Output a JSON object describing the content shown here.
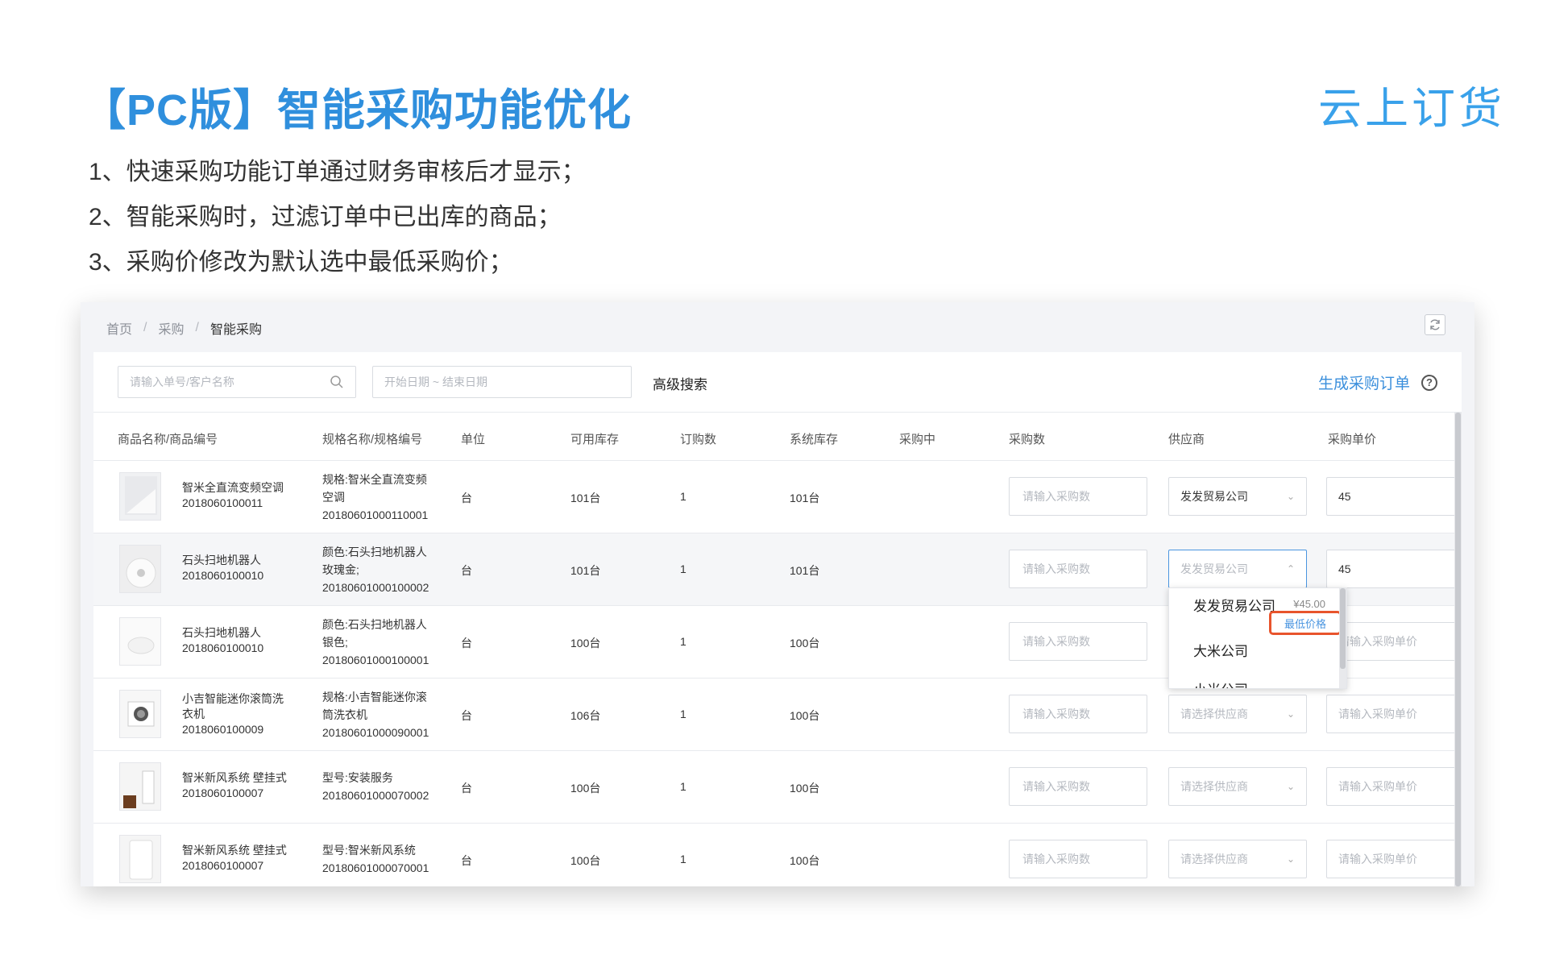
{
  "slide": {
    "title": "【PC版】智能采购功能优化",
    "brand": "云上订货",
    "notes": [
      "1、快速采购功能订单通过财务审核后才显示；",
      "2、智能采购时，过滤订单中已出库的商品；",
      "3、采购价修改为默认选中最低采购价；"
    ]
  },
  "breadcrumb": {
    "home": "首页",
    "sep": "/",
    "purchase": "采购",
    "current": "智能采购"
  },
  "toolbar": {
    "search_placeholder": "请输入单号/客户名称",
    "date_placeholder": "开始日期 ~ 结束日期",
    "advanced_search": "高级搜索",
    "generate_order": "生成采购订单",
    "help": "?"
  },
  "table": {
    "headers": [
      "商品名称/商品编号",
      "规格名称/规格编号",
      "单位",
      "可用库存",
      "订购数",
      "系统库存",
      "采购中",
      "采购数",
      "供应商",
      "采购单价"
    ],
    "qty_placeholder": "请输入采购数",
    "supplier_placeholder": "请选择供应商",
    "price_placeholder": "请输入采购单价",
    "rows": [
      {
        "name1": "智米全直流变频空调",
        "name2": "2018060100011",
        "name3": "",
        "spec1": "规格:智米全直流变频",
        "spec2": "空调",
        "spec3": "20180601000110001",
        "unit": "台",
        "available": "101台",
        "ordered": "1",
        "system": "101台",
        "supplier": "发发贸易公司",
        "price": "45"
      },
      {
        "name1": "石头扫地机器人",
        "name2": "2018060100010",
        "name3": "",
        "spec1": "颜色:石头扫地机器人",
        "spec2": "玫瑰金;",
        "spec3": "20180601000100002",
        "unit": "台",
        "available": "101台",
        "ordered": "1",
        "system": "101台",
        "supplier": "发发贸易公司",
        "price": "45"
      },
      {
        "name1": "石头扫地机器人",
        "name2": "2018060100010",
        "name3": "",
        "spec1": "颜色:石头扫地机器人",
        "spec2": "银色;",
        "spec3": "20180601000100001",
        "unit": "台",
        "available": "100台",
        "ordered": "1",
        "system": "100台",
        "supplier": "",
        "price": ""
      },
      {
        "name1": "小吉智能迷你滚筒洗",
        "name2": "衣机",
        "name3": "2018060100009",
        "spec1": "规格:小吉智能迷你滚",
        "spec2": "筒洗衣机",
        "spec3": "20180601000090001",
        "unit": "台",
        "available": "106台",
        "ordered": "1",
        "system": "100台",
        "supplier": "",
        "price": ""
      },
      {
        "name1": "智米新风系统 壁挂式",
        "name2": "2018060100007",
        "name3": "",
        "spec1": "型号:安装服务",
        "spec2": "20180601000070002",
        "spec3": "",
        "unit": "台",
        "available": "100台",
        "ordered": "1",
        "system": "100台",
        "supplier": "",
        "price": ""
      },
      {
        "name1": "智米新风系统 壁挂式",
        "name2": "2018060100007",
        "name3": "",
        "spec1": "型号:智米新风系统",
        "spec2": "20180601000070001",
        "spec3": "",
        "unit": "台",
        "available": "100台",
        "ordered": "1",
        "system": "100台",
        "supplier": "",
        "price": ""
      }
    ]
  },
  "dropdown": {
    "option1": "发发贸易公司",
    "option1_price": "¥45.00",
    "lowest_tag": "最低价格",
    "option2": "大米公司",
    "option3": "小米公司"
  },
  "colors": {
    "title": "#2f8fdd",
    "brand": "#39a1ea",
    "link": "#3b8fdc",
    "highlight_border": "#e8542c"
  },
  "icons": [
    "search-icon",
    "calendar-icon",
    "refresh-icon",
    "help-icon",
    "chevron-down-icon",
    "chevron-up-icon"
  ]
}
